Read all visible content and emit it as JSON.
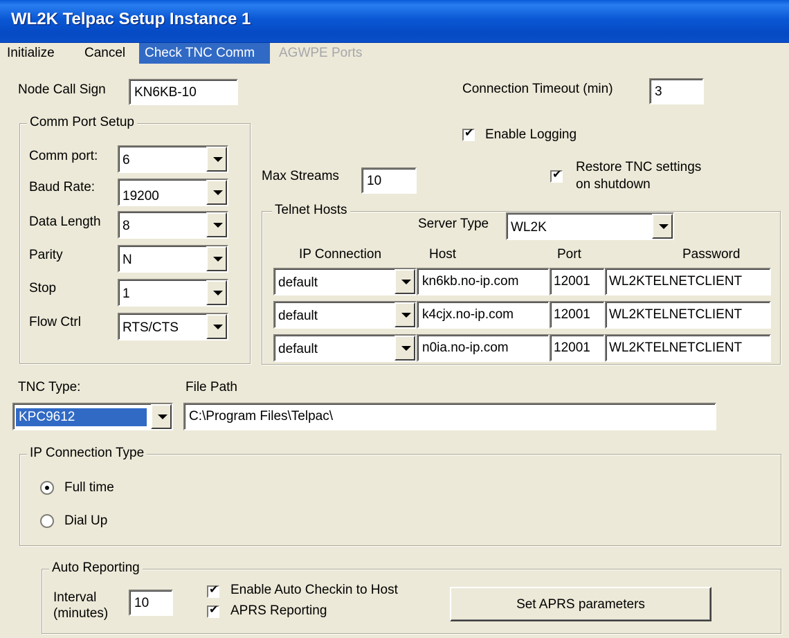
{
  "window": {
    "title": "WL2K Telpac Setup Instance 1"
  },
  "menu": {
    "items": [
      {
        "label": "Initialize",
        "state": "normal"
      },
      {
        "label": "Cancel",
        "state": "normal"
      },
      {
        "label": "Check TNC Comm",
        "state": "active"
      },
      {
        "label": "AGWPE Ports",
        "state": "disabled"
      }
    ]
  },
  "node": {
    "label": "Node Call Sign",
    "value": "KN6KB-10"
  },
  "timeout": {
    "label": "Connection Timeout (min)",
    "value": "3"
  },
  "logging": {
    "label": "Enable Logging",
    "checked": true
  },
  "restore": {
    "label_line1": "Restore TNC settings",
    "label_line2": "on shutdown",
    "checked": true
  },
  "max_streams": {
    "label": "Max Streams",
    "value": "10"
  },
  "comm_port_setup": {
    "title": "Comm Port Setup",
    "fields": [
      {
        "label": "Comm port:",
        "value": "6"
      },
      {
        "label": "Baud Rate:",
        "value": "19200"
      },
      {
        "label": "Data Length",
        "value": "8"
      },
      {
        "label": "Parity",
        "value": "N"
      },
      {
        "label": "Stop",
        "value": "1"
      },
      {
        "label": "Flow Ctrl",
        "value": "RTS/CTS"
      }
    ]
  },
  "telnet_hosts": {
    "title": "Telnet Hosts",
    "server_type_label": "Server Type",
    "server_type_value": "WL2K",
    "headers": {
      "ip_connection": "IP Connection",
      "host": "Host",
      "port": "Port",
      "password": "Password"
    },
    "rows": [
      {
        "ip": "default",
        "host": "kn6kb.no-ip.com",
        "port": "12001",
        "password": "WL2KTELNETCLIENT"
      },
      {
        "ip": "default",
        "host": "k4cjx.no-ip.com",
        "port": "12001",
        "password": "WL2KTELNETCLIENT"
      },
      {
        "ip": "default",
        "host": "n0ia.no-ip.com",
        "port": "12001",
        "password": "WL2KTELNETCLIENT"
      }
    ]
  },
  "tnc": {
    "label": "TNC Type:",
    "value": "KPC9612"
  },
  "file_path": {
    "label": "File Path",
    "value": "C:\\Program Files\\Telpac\\"
  },
  "ip_connection_type": {
    "title": "IP Connection Type",
    "options": [
      {
        "label": "Full time",
        "selected": true
      },
      {
        "label": "Dial Up",
        "selected": false
      }
    ]
  },
  "auto_reporting": {
    "title": "Auto Reporting",
    "interval_label_line1": "Interval",
    "interval_label_line2": "(minutes)",
    "interval_value": "10",
    "auto_checkin_label": "Enable Auto Checkin to Host",
    "auto_checkin_checked": true,
    "aprs_label": "APRS Reporting",
    "aprs_checked": true,
    "set_aprs_button": "Set APRS parameters"
  },
  "icons": {
    "dropdown": "chevron-down-icon",
    "check": "checkmark-icon",
    "radio": "radio-dot-icon"
  },
  "colors": {
    "title_bar": "#0a58d4",
    "menu_active": "#316ac5",
    "dialog_bg": "#ece9d8",
    "disabled_text": "#a7a6aa"
  }
}
